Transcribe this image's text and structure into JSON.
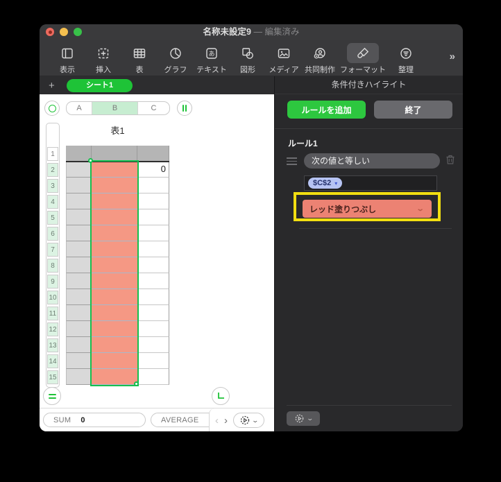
{
  "window": {
    "title": "名称未設定9",
    "edited_suffix": " — 編集済み",
    "overflow_chevron": "»"
  },
  "toolbar": {
    "items": [
      {
        "label": "表示",
        "icon": "view-icon",
        "selected": false
      },
      {
        "label": "挿入",
        "icon": "insert-icon",
        "selected": false
      },
      {
        "label": "表",
        "icon": "table-icon",
        "selected": false
      },
      {
        "label": "グラフ",
        "icon": "chart-icon",
        "selected": false
      },
      {
        "label": "テキスト",
        "icon": "text-icon",
        "selected": false
      },
      {
        "label": "図形",
        "icon": "shape-icon",
        "selected": false
      },
      {
        "label": "メディア",
        "icon": "media-icon",
        "selected": false
      },
      {
        "label": "共同制作",
        "icon": "collaborate-icon",
        "selected": false
      },
      {
        "label": "フォーマット",
        "icon": "format-icon",
        "selected": true
      },
      {
        "label": "整理",
        "icon": "organize-icon",
        "selected": false
      }
    ]
  },
  "sheetbar": {
    "add_button": "+",
    "tab_label": "シート1"
  },
  "refbar": {
    "columns": [
      "A",
      "B",
      "C"
    ],
    "selected_column": "B"
  },
  "sheet": {
    "table_title": "表1",
    "row_numbers": [
      "1",
      "2",
      "3",
      "4",
      "5",
      "6",
      "7",
      "8",
      "9",
      "10",
      "11",
      "12",
      "13",
      "14",
      "15"
    ],
    "body_row_count": 14,
    "cell_values": {
      "C2": "0"
    },
    "highlight_fill": "#f59884"
  },
  "quickcalc": {
    "sum_label": "SUM",
    "sum_value": "0",
    "average_label": "AVERAGE",
    "prev": "‹",
    "next": "›"
  },
  "panel": {
    "title": "条件付きハイライト",
    "add_rule_button": "ルールを追加",
    "done_button": "終了",
    "rule_name": "ルール1",
    "condition_dropdown": "次の値と等しい",
    "value_token": "$C$2",
    "token_arrow": "▾",
    "style_dropdown": "レッド塗りつぶし",
    "style_chevron": "⌄"
  },
  "colors": {
    "accent_green": "#1ec337",
    "selection_green": "#16bf4f",
    "cell_highlight": "#f59884",
    "style_dropdown_fill": "#ec8273",
    "annotation_yellow": "#f2de11",
    "token_blue": "#b6c3f3"
  }
}
